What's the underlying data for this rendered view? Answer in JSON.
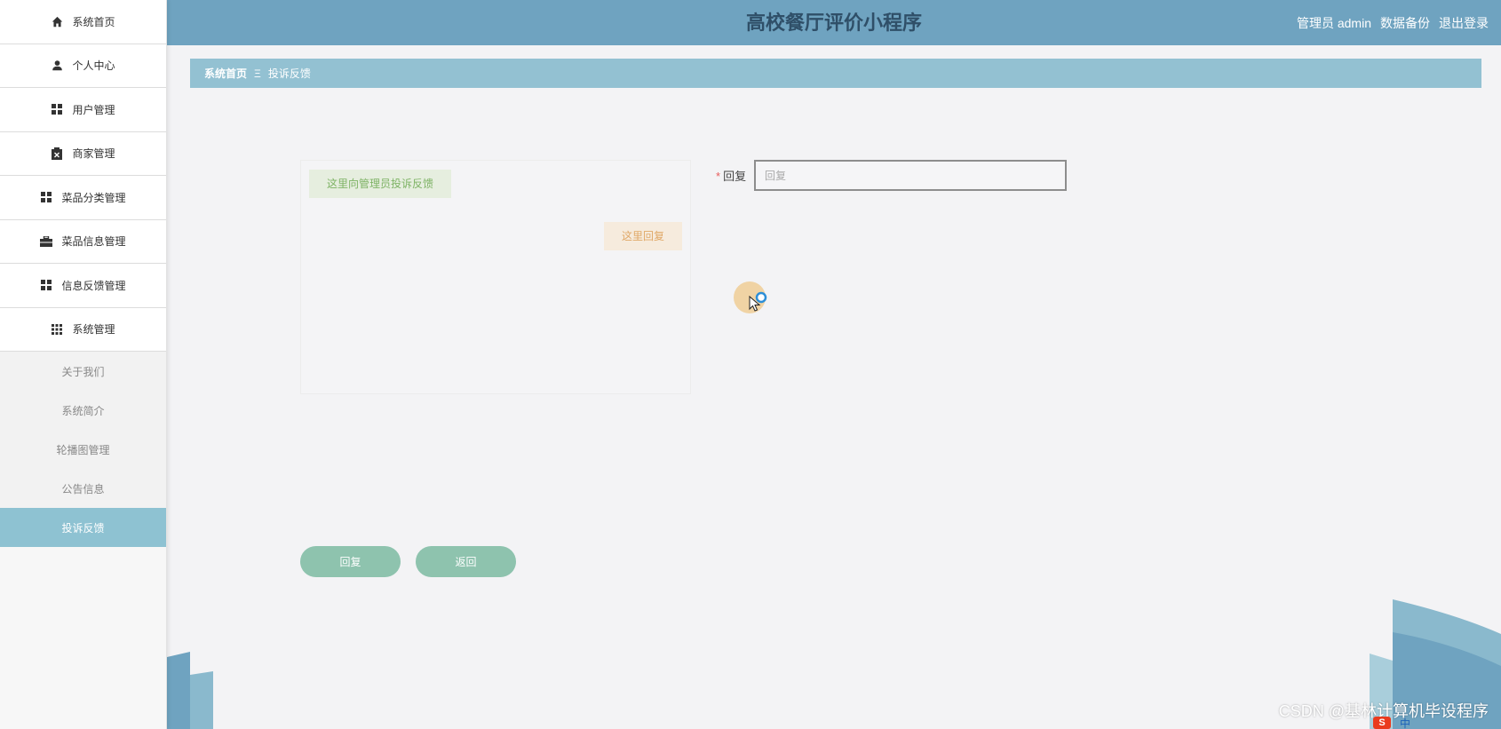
{
  "header": {
    "title": "高校餐厅评价小程序",
    "user_role": "管理员 admin",
    "backup_label": "数据备份",
    "logout_label": "退出登录"
  },
  "sidebar": {
    "items": [
      {
        "label": "系统首页",
        "icon": "home-icon"
      },
      {
        "label": "个人中心",
        "icon": "user-icon"
      },
      {
        "label": "用户管理",
        "icon": "grid-icon"
      },
      {
        "label": "商家管理",
        "icon": "clipboard-icon"
      },
      {
        "label": "菜品分类管理",
        "icon": "grid-icon"
      },
      {
        "label": "菜品信息管理",
        "icon": "briefcase-icon"
      },
      {
        "label": "信息反馈管理",
        "icon": "grid-icon"
      },
      {
        "label": "系统管理",
        "icon": "apps-icon"
      }
    ],
    "subitems": [
      {
        "label": "关于我们"
      },
      {
        "label": "系统简介"
      },
      {
        "label": "轮播图管理"
      },
      {
        "label": "公告信息"
      },
      {
        "label": "投诉反馈",
        "active": true
      }
    ]
  },
  "breadcrumb": {
    "home": "系统首页",
    "separator": "Ξ",
    "current": "投诉反馈"
  },
  "chat": {
    "left_message": "这里向管理员投诉反馈",
    "right_message": "这里回复"
  },
  "form": {
    "required_mark": "*",
    "reply_label": "回复",
    "reply_placeholder": "回复",
    "reply_value": ""
  },
  "buttons": {
    "reply": "回复",
    "back": "返回"
  },
  "watermark": "CSDN @基林计算机毕设程序",
  "tray": {
    "ime_logo": "S",
    "ime_mode": "中"
  },
  "colors": {
    "header_bg": "#6fa3c0",
    "breadcrumb_bg": "#93c1d2",
    "active_sidebar": "#8ec2d2",
    "button_bg": "#8ec3ae"
  }
}
